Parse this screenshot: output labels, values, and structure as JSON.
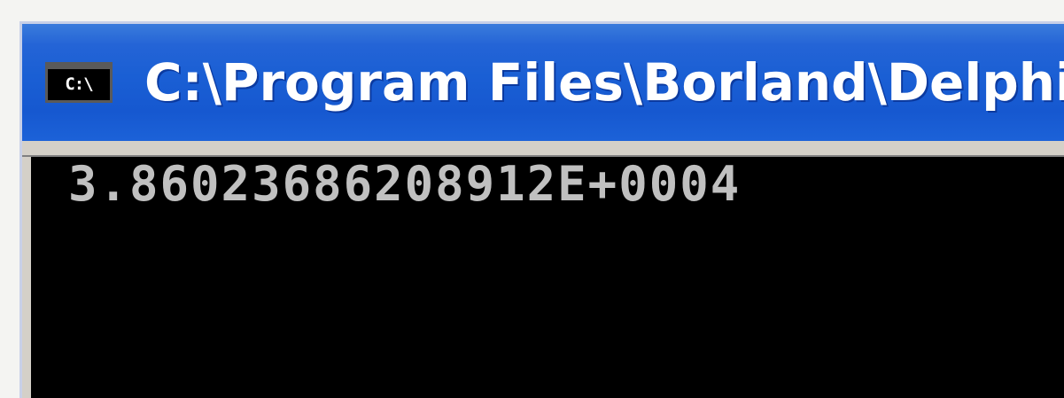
{
  "window": {
    "title": "C:\\Program Files\\Borland\\Delphi",
    "icon_text": "C:\\",
    "icon_name": "command-prompt-icon"
  },
  "console": {
    "lines": [
      "3.86023686208912E+0004"
    ]
  },
  "colors": {
    "title_bar": "#1a5fd4",
    "console_bg": "#000000",
    "console_text": "#c0c0c0"
  }
}
